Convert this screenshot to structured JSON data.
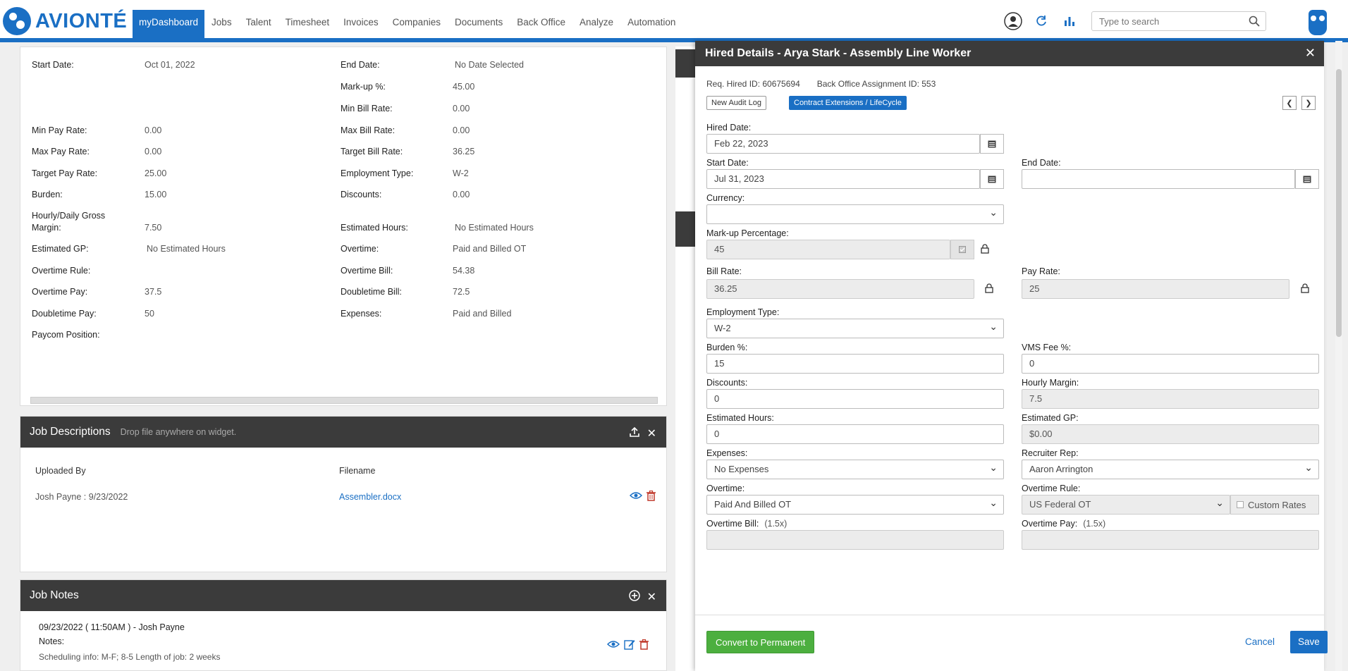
{
  "app": {
    "brand": "AVIONTÉ",
    "brand_color": "#1a6fc4"
  },
  "nav": {
    "items": [
      "myDashboard",
      "Jobs",
      "Talent",
      "Timesheet",
      "Invoices",
      "Companies",
      "Documents",
      "Back Office",
      "Analyze",
      "Automation"
    ],
    "active": "myDashboard"
  },
  "search": {
    "placeholder": "Type to search"
  },
  "financials": {
    "left": [
      {
        "label": "Start Date:",
        "value": "Oct 01, 2022"
      },
      {
        "label": "Min Pay Rate:",
        "value": "0.00"
      },
      {
        "label": "Max Pay Rate:",
        "value": "0.00"
      },
      {
        "label": "Target Pay Rate:",
        "value": "25.00"
      },
      {
        "label": "Burden:",
        "value": "15.00"
      },
      {
        "label": "Hourly/Daily Gross",
        "label2": "Margin:",
        "value": "7.50"
      },
      {
        "label": "Estimated GP:",
        "value": "No Estimated Hours"
      },
      {
        "label": "Overtime Rule:",
        "value": ""
      },
      {
        "label": "Overtime Pay:",
        "value": "37.5"
      },
      {
        "label": "Doubletime Pay:",
        "value": "50"
      },
      {
        "label": "Paycom Position:",
        "value": ""
      }
    ],
    "right": [
      {
        "label": "End Date:",
        "value": "No Date Selected"
      },
      {
        "label": "Mark-up %:",
        "value": "45.00"
      },
      {
        "label": "Min Bill Rate:",
        "value": "0.00"
      },
      {
        "label": "Max Bill Rate:",
        "value": "0.00"
      },
      {
        "label": "Target Bill Rate:",
        "value": "36.25"
      },
      {
        "label": "Employment Type:",
        "value": "W-2"
      },
      {
        "label": "Discounts:",
        "value": "0.00"
      },
      {
        "label": "Estimated Hours:",
        "value": "No Estimated Hours"
      },
      {
        "label": "Overtime:",
        "value": "Paid and Billed OT"
      },
      {
        "label": "Overtime Bill:",
        "value": "54.38"
      },
      {
        "label": "Doubletime Bill:",
        "value": "72.5"
      },
      {
        "label": "Expenses:",
        "value": "Paid and Billed"
      }
    ]
  },
  "job_descriptions": {
    "title": "Job Descriptions",
    "subtitle": "Drop file anywhere on widget.",
    "columns": [
      "Uploaded By",
      "Filename"
    ],
    "rows": [
      {
        "uploaded_by": "Josh Payne : 9/23/2022",
        "filename": "Assembler.docx"
      }
    ]
  },
  "job_notes": {
    "title": "Job Notes",
    "entry_header": "09/23/2022 ( 11:50AM ) - Josh Payne",
    "notes_label": "Notes:",
    "notes_text": "Scheduling info: M-F; 8-5 Length of job: 2 weeks"
  },
  "modal": {
    "title": "Hired Details - Arya Stark - Assembly Line Worker",
    "req_hired_id": "Req. Hired ID: 60675694",
    "back_office_id": "Back Office Assignment ID: 553",
    "audit_button": "New Audit Log",
    "contract_button": "Contract Extensions / LifeCycle",
    "fields": {
      "hired_date": {
        "label": "Hired Date:",
        "value": "Feb 22, 2023"
      },
      "start_date": {
        "label": "Start Date:",
        "value": "Jul 31, 2023"
      },
      "end_date": {
        "label": "End Date:",
        "value": ""
      },
      "currency": {
        "label": "Currency:",
        "value": ""
      },
      "markup": {
        "label": "Mark-up Percentage:",
        "value": "45"
      },
      "bill_rate": {
        "label": "Bill Rate:",
        "value": "36.25"
      },
      "pay_rate": {
        "label": "Pay Rate:",
        "value": "25"
      },
      "employment_type": {
        "label": "Employment Type:",
        "value": "W-2"
      },
      "burden": {
        "label": "Burden %:",
        "value": "15"
      },
      "vms_fee": {
        "label": "VMS Fee %:",
        "value": "0"
      },
      "discounts": {
        "label": "Discounts:",
        "value": "0"
      },
      "hourly_margin": {
        "label": "Hourly Margin:",
        "value": "7.5"
      },
      "estimated_hours": {
        "label": "Estimated Hours:",
        "value": "0"
      },
      "estimated_gp": {
        "label": "Estimated GP:",
        "value": "$0.00"
      },
      "expenses": {
        "label": "Expenses:",
        "value": "No Expenses"
      },
      "recruiter_rep": {
        "label": "Recruiter Rep:",
        "value": "Aaron Arrington"
      },
      "overtime": {
        "label": "Overtime:",
        "value": "Paid And Billed OT"
      },
      "overtime_rule": {
        "label": "Overtime Rule:",
        "value": "US Federal OT"
      },
      "custom_rates": "Custom Rates",
      "overtime_bill": {
        "label": "Overtime Bill:",
        "multiplier": "(1.5x)"
      },
      "overtime_pay": {
        "label": "Overtime Pay:",
        "multiplier": "(1.5x)"
      }
    },
    "footer": {
      "convert": "Convert to Permanent",
      "cancel": "Cancel",
      "save": "Save"
    }
  }
}
